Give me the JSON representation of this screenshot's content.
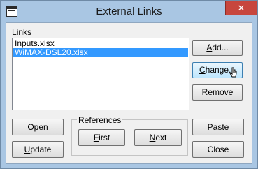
{
  "window": {
    "title": "External Links",
    "close_glyph": "✕"
  },
  "links": {
    "label_accel": "L",
    "label_rest": "inks",
    "items": [
      {
        "name": "Inputs.xlsx",
        "selected": false
      },
      {
        "name": "WiMAX-DSL20.xlsx",
        "selected": true
      }
    ]
  },
  "buttons": {
    "add": {
      "accel": "A",
      "rest": "dd..."
    },
    "change": {
      "accel": "C",
      "rest": "hange..."
    },
    "remove": {
      "accel": "R",
      "rest": "emove"
    },
    "open": {
      "accel": "O",
      "rest": "pen"
    },
    "update": {
      "accel": "U",
      "rest": "pdate"
    },
    "first": {
      "accel": "F",
      "rest": "irst"
    },
    "next": {
      "accel": "N",
      "rest": "ext"
    },
    "paste": {
      "accel": "P",
      "rest": "aste"
    },
    "close": {
      "label": "Close"
    }
  },
  "references": {
    "label": "References"
  },
  "colors": {
    "selection": "#3399ff",
    "title_bar": "#a9c6e3",
    "close_button": "#c7463d"
  }
}
